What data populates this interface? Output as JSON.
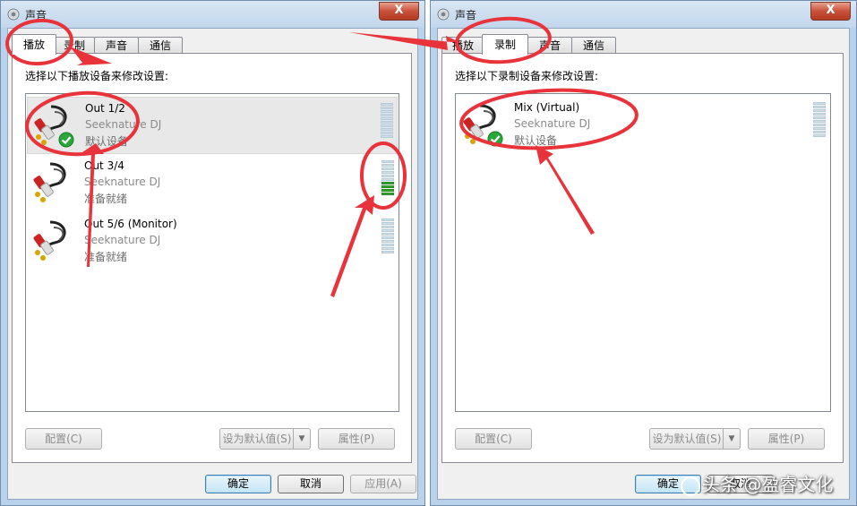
{
  "left_window": {
    "title": "声音",
    "close_label": "X",
    "tabs": [
      "播放",
      "录制",
      "声音",
      "通信"
    ],
    "active_tab": 0,
    "instruction": "选择以下播放设备来修改设置:",
    "devices": [
      {
        "name": "Out 1/2",
        "driver": "Seeknature DJ",
        "status": "默认设备",
        "default": true,
        "meter_level": 0
      },
      {
        "name": "Out 3/4",
        "driver": "Seeknature DJ",
        "status": "准备就绪",
        "default": false,
        "meter_level": 0.4
      },
      {
        "name": "Out 5/6 (Monitor)",
        "driver": "Seeknature DJ",
        "status": "准备就绪",
        "default": false,
        "meter_level": 0
      }
    ],
    "buttons": {
      "configure": "配置(C)",
      "set_default": "设为默认值(S)",
      "properties": "属性(P)"
    },
    "footer": {
      "ok": "确定",
      "cancel": "取消",
      "apply": "应用(A)"
    }
  },
  "right_window": {
    "title": "声音",
    "close_label": "X",
    "tabs": [
      "播放",
      "录制",
      "声音",
      "通信"
    ],
    "active_tab": 1,
    "instruction": "选择以下录制设备来修改设置:",
    "devices": [
      {
        "name": "Mix (Virtual)",
        "driver": "Seeknature DJ",
        "status": "默认设备",
        "default": true,
        "meter_level": 0
      }
    ],
    "buttons": {
      "configure": "配置(C)",
      "set_default": "设为默认值(S)",
      "properties": "属性(P)"
    },
    "footer": {
      "ok": "确定",
      "cancel": "取消"
    }
  },
  "watermark": "头条 @盈睿文化",
  "colors": {
    "annotation": "#e8333a",
    "window_frame": "#b9d1ea",
    "meter_on": "#3aa23a"
  }
}
